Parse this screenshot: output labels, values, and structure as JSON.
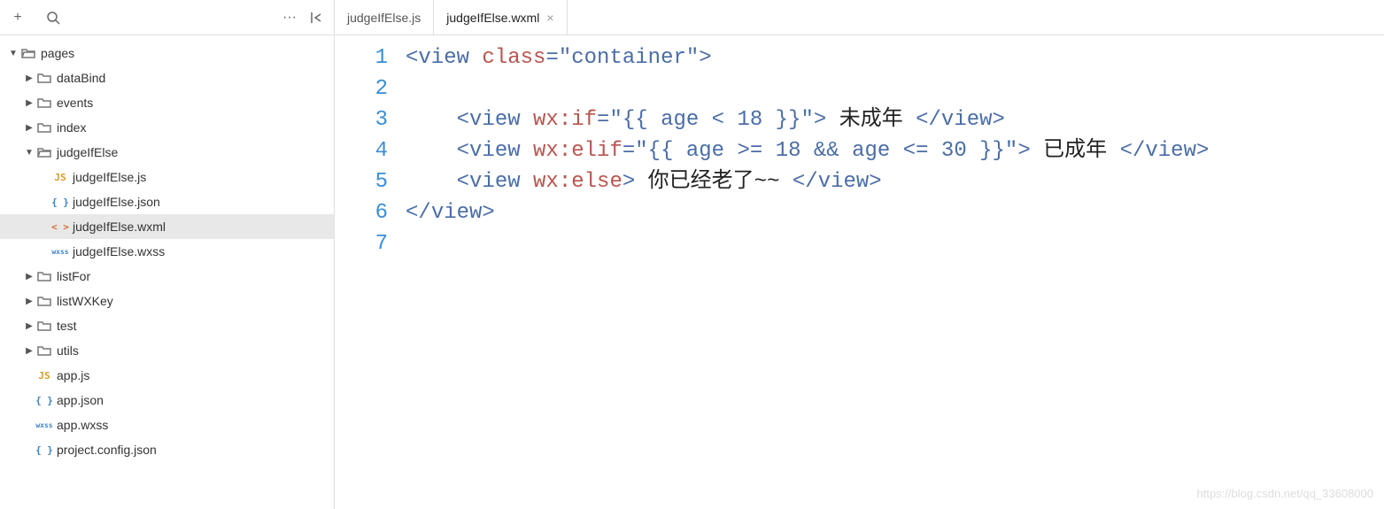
{
  "tabs": [
    {
      "label": "judgeIfElse.js",
      "active": false
    },
    {
      "label": "judgeIfElse.wxml",
      "active": true
    }
  ],
  "tree": {
    "root": {
      "name": "pages",
      "items": [
        {
          "name": "dataBind",
          "type": "folder",
          "depth": 1
        },
        {
          "name": "events",
          "type": "folder",
          "depth": 1
        },
        {
          "name": "index",
          "type": "folder",
          "depth": 1
        },
        {
          "name": "judgeIfElse",
          "type": "folder-open",
          "depth": 1,
          "children": [
            {
              "name": "judgeIfElse.js",
              "type": "js",
              "depth": 2
            },
            {
              "name": "judgeIfElse.json",
              "type": "json",
              "depth": 2
            },
            {
              "name": "judgeIfElse.wxml",
              "type": "wxml",
              "depth": 2,
              "selected": true
            },
            {
              "name": "judgeIfElse.wxss",
              "type": "wxss",
              "depth": 2
            }
          ]
        },
        {
          "name": "listFor",
          "type": "folder",
          "depth": 1
        },
        {
          "name": "listWXKey",
          "type": "folder",
          "depth": 1
        },
        {
          "name": "test",
          "type": "folder",
          "depth": 1
        },
        {
          "name": "utils",
          "type": "folder",
          "depth": 1
        },
        {
          "name": "app.js",
          "type": "js",
          "depth": 1
        },
        {
          "name": "app.json",
          "type": "json",
          "depth": 1
        },
        {
          "name": "app.wxss",
          "type": "wxss",
          "depth": 1
        },
        {
          "name": "project.config.json",
          "type": "json",
          "depth": 1
        }
      ]
    }
  },
  "code": {
    "lines": [
      {
        "n": "1",
        "tokens": [
          {
            "t": "<",
            "c": "tag-bracket"
          },
          {
            "t": "view",
            "c": "tag-name"
          },
          {
            "t": " "
          },
          {
            "t": "class",
            "c": "attr-name"
          },
          {
            "t": "=",
            "c": "tag-bracket"
          },
          {
            "t": "\"container\"",
            "c": "attr-value"
          },
          {
            "t": ">",
            "c": "tag-bracket"
          }
        ]
      },
      {
        "n": "2",
        "tokens": []
      },
      {
        "n": "3",
        "tokens": [
          {
            "t": "    "
          },
          {
            "t": "<",
            "c": "tag-bracket"
          },
          {
            "t": "view",
            "c": "tag-name"
          },
          {
            "t": " "
          },
          {
            "t": "wx:if",
            "c": "attr-name"
          },
          {
            "t": "=",
            "c": "tag-bracket"
          },
          {
            "t": "\"{{ age < 18 }}\"",
            "c": "attr-value"
          },
          {
            "t": ">",
            "c": "tag-bracket"
          },
          {
            "t": " 未成年 ",
            "c": "text-content"
          },
          {
            "t": "</",
            "c": "tag-bracket"
          },
          {
            "t": "view",
            "c": "tag-name"
          },
          {
            "t": ">",
            "c": "tag-bracket"
          }
        ]
      },
      {
        "n": "4",
        "tokens": [
          {
            "t": "    "
          },
          {
            "t": "<",
            "c": "tag-bracket"
          },
          {
            "t": "view",
            "c": "tag-name"
          },
          {
            "t": " "
          },
          {
            "t": "wx:elif",
            "c": "attr-name"
          },
          {
            "t": "=",
            "c": "tag-bracket"
          },
          {
            "t": "\"{{ age >= 18 && age <= 30 }}\"",
            "c": "attr-value"
          },
          {
            "t": ">",
            "c": "tag-bracket"
          },
          {
            "t": " 已成年 ",
            "c": "text-content"
          },
          {
            "t": "</",
            "c": "tag-bracket"
          },
          {
            "t": "view",
            "c": "tag-name"
          },
          {
            "t": ">",
            "c": "tag-bracket"
          }
        ]
      },
      {
        "n": "5",
        "tokens": [
          {
            "t": "    "
          },
          {
            "t": "<",
            "c": "tag-bracket"
          },
          {
            "t": "view",
            "c": "tag-name"
          },
          {
            "t": " "
          },
          {
            "t": "wx:else",
            "c": "attr-name"
          },
          {
            "t": ">",
            "c": "tag-bracket"
          },
          {
            "t": " 你已经老了~~ ",
            "c": "text-content"
          },
          {
            "t": "</",
            "c": "tag-bracket"
          },
          {
            "t": "view",
            "c": "tag-name"
          },
          {
            "t": ">",
            "c": "tag-bracket"
          }
        ]
      },
      {
        "n": "6",
        "tokens": [
          {
            "t": "</",
            "c": "tag-bracket"
          },
          {
            "t": "view",
            "c": "tag-name"
          },
          {
            "t": ">",
            "c": "tag-bracket"
          }
        ]
      },
      {
        "n": "7",
        "tokens": []
      }
    ]
  },
  "icons": {
    "plus": "+",
    "more": "···",
    "close": "×",
    "js": "JS",
    "json": "{ }",
    "wxml": "< >",
    "wxss": "wxss"
  },
  "watermark": "https://blog.csdn.net/qq_33608000"
}
